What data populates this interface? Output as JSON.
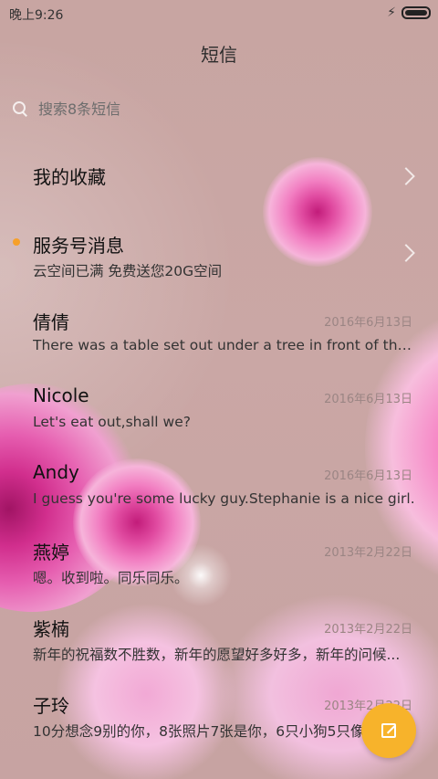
{
  "statusbar": {
    "time": "晚上9:26",
    "charging_symbol": "⚡"
  },
  "header": {
    "title": "短信"
  },
  "search": {
    "placeholder": "搜索8条短信"
  },
  "rows": [
    {
      "title": "我的收藏",
      "subtitle": "",
      "date": "",
      "has_chevron": true,
      "unread": false
    },
    {
      "title": "服务号消息",
      "subtitle": "云空间已满 免费送您20G空间",
      "date": "",
      "has_chevron": true,
      "unread": true
    },
    {
      "title": "倩倩",
      "subtitle": "There was a table set out under a tree in front of the ho...",
      "date": "2016年6月13日"
    },
    {
      "title": "Nicole",
      "subtitle": "Let's eat out,shall we?",
      "date": "2016年6月13日"
    },
    {
      "title": "Andy",
      "subtitle": "I guess you're some lucky guy.Stephanie is a nice girl.",
      "date": "2016年6月13日"
    },
    {
      "title": "燕婷",
      "subtitle": "嗯。收到啦。同乐同乐。",
      "date": "2013年2月22日"
    },
    {
      "title": "紫楠",
      "subtitle": "新年的祝福数不胜数，新年的愿望好多好多，新年的问候...",
      "date": "2013年2月22日"
    },
    {
      "title": "子玲",
      "subtitle": "10分想念9别的你，8张照片7张是你，6只小狗5只像你",
      "date": "2013年2月22日"
    }
  ],
  "colors": {
    "accent": "#f7b32b",
    "unread_dot": "#f6a02a",
    "background": "#c9a7a4"
  },
  "icons": {
    "search": "search-icon",
    "chevron": "chevron-right-icon",
    "compose": "compose-icon",
    "battery": "battery-icon"
  }
}
